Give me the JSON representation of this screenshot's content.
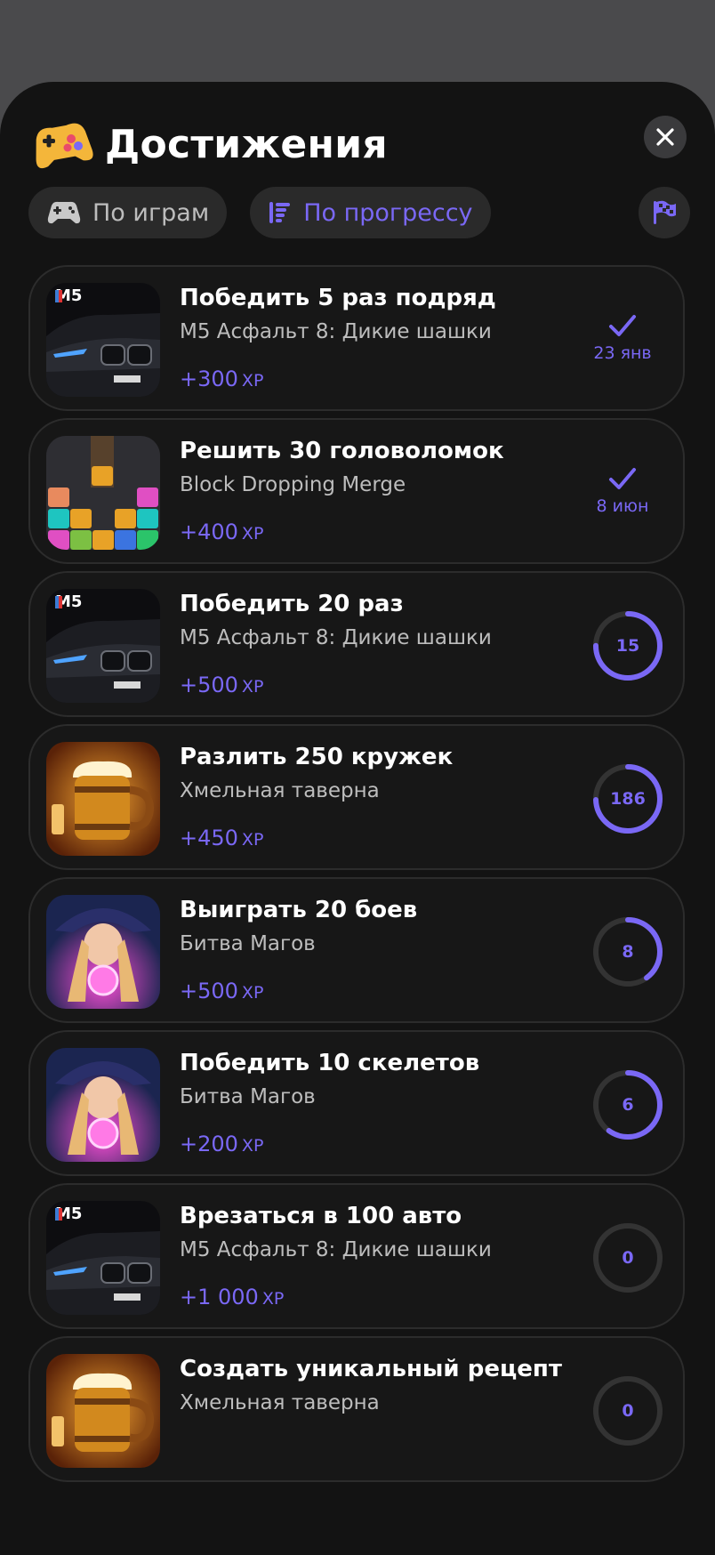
{
  "header": {
    "title": "Достижения"
  },
  "tabs": [
    {
      "label": "По играм",
      "active": false,
      "icon": "gamepad-icon"
    },
    {
      "label": "По прогрессу",
      "active": true,
      "icon": "progress-list-icon"
    }
  ],
  "colors": {
    "accent": "#7a68f5",
    "background": "#131313",
    "card": "#171717"
  },
  "achievements": [
    {
      "title": "Победить 5 раз подряд",
      "game": "M5 Асфальт 8: Дикие шашки",
      "xp": "+300",
      "xp_unit": "XP",
      "status": "done",
      "date": "23 янв",
      "thumb": "car"
    },
    {
      "title": "Решить 30 головоломок",
      "game": "Block Dropping Merge",
      "xp": "+400",
      "xp_unit": "XP",
      "status": "done",
      "date": "8 июн",
      "thumb": "blocks"
    },
    {
      "title": "Победить 20 раз",
      "game": "M5 Асфальт 8: Дикие шашки",
      "xp": "+500",
      "xp_unit": "XP",
      "status": "progress",
      "count": "15",
      "progress": 0.75,
      "thumb": "car"
    },
    {
      "title": "Разлить 250 кружек",
      "game": "Хмельная таверна",
      "xp": "+450",
      "xp_unit": "XP",
      "status": "progress",
      "count": "186",
      "progress": 0.744,
      "thumb": "beer"
    },
    {
      "title": "Выиграть 20 боев",
      "game": "Битва Магов",
      "xp": "+500",
      "xp_unit": "XP",
      "status": "progress",
      "count": "8",
      "progress": 0.4,
      "thumb": "mage"
    },
    {
      "title": "Победить 10 скелетов",
      "game": "Битва Магов",
      "xp": "+200",
      "xp_unit": "XP",
      "status": "progress",
      "count": "6",
      "progress": 0.6,
      "thumb": "mage"
    },
    {
      "title": "Врезаться в 100 авто",
      "game": "M5 Асфальт 8: Дикие шашки",
      "xp": "+1 000",
      "xp_unit": "XP",
      "status": "progress",
      "count": "0",
      "progress": 0,
      "thumb": "car"
    },
    {
      "title": "Создать уникальный рецепт",
      "game": "Хмельная таверна",
      "xp": "",
      "xp_unit": "",
      "status": "progress",
      "count": "0",
      "progress": 0,
      "thumb": "beer"
    }
  ]
}
